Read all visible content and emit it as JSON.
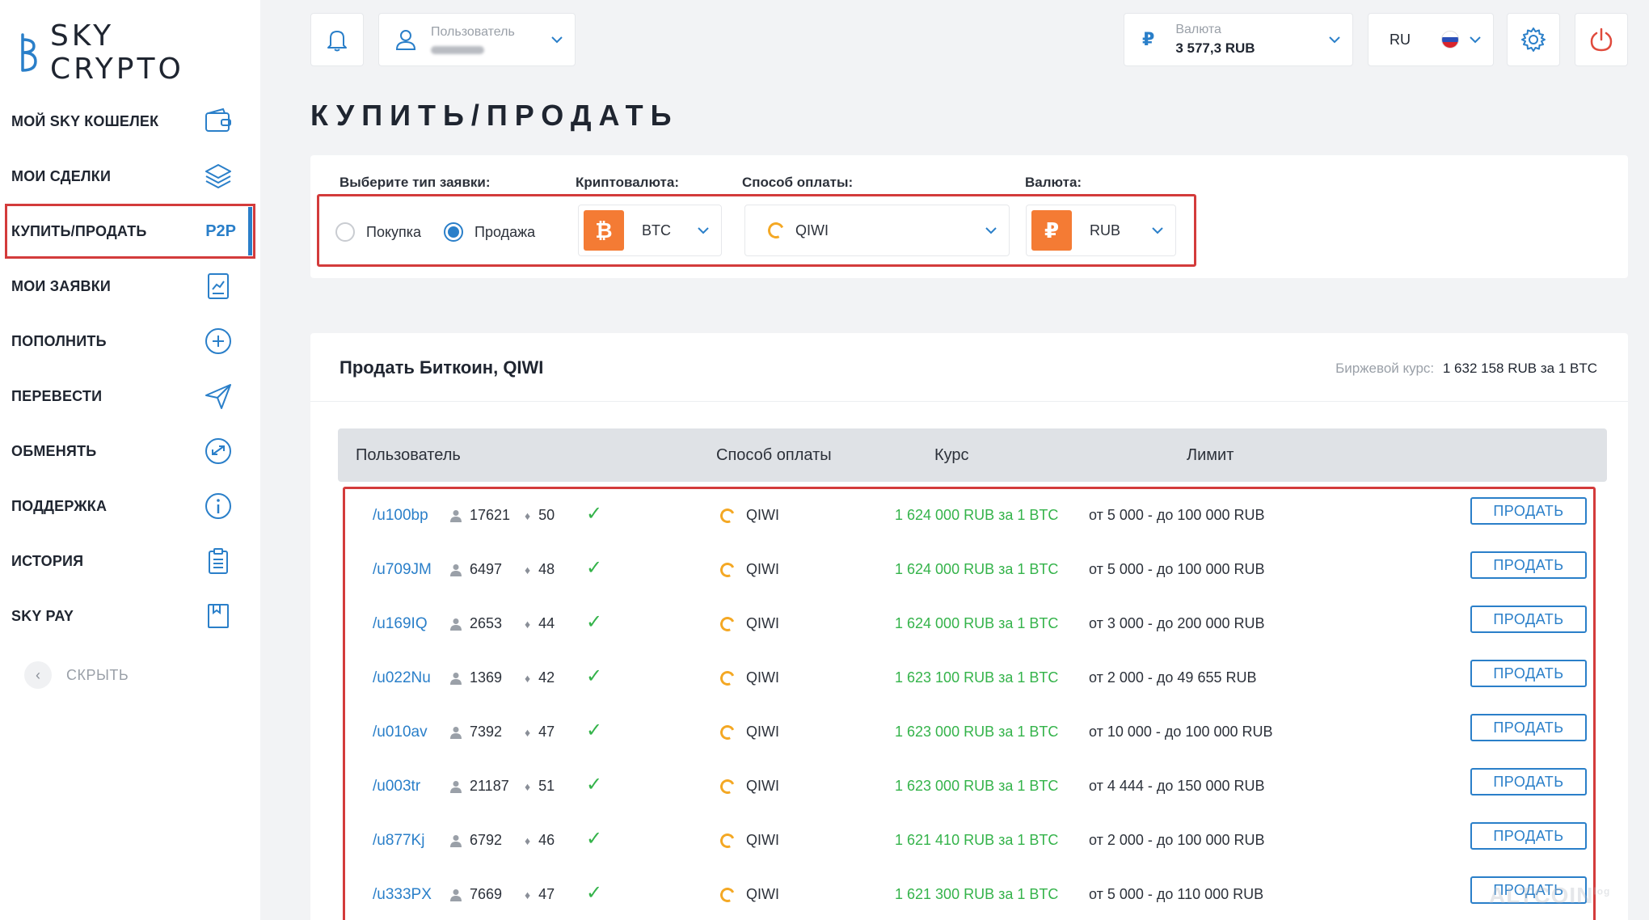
{
  "app": {
    "logo_text": "SKY CRYPTO"
  },
  "sidebar": {
    "items": [
      {
        "label": "МОЙ SKY КОШЕЛЕК",
        "icon": "wallet-icon"
      },
      {
        "label": "МОИ СДЕЛКИ",
        "icon": "layers-icon"
      },
      {
        "label": "КУПИТЬ/ПРОДАТЬ",
        "badge": "P2P",
        "active": true
      },
      {
        "label": "МОИ ЗАЯВКИ",
        "icon": "report-icon"
      },
      {
        "label": "ПОПОЛНИТЬ",
        "icon": "plus-circle-icon"
      },
      {
        "label": "ПЕРЕВЕСТИ",
        "icon": "send-icon"
      },
      {
        "label": "ОБМЕНЯТЬ",
        "icon": "exchange-icon"
      },
      {
        "label": "ПОДДЕРЖКА",
        "icon": "info-icon"
      },
      {
        "label": "ИСТОРИЯ",
        "icon": "clipboard-icon"
      },
      {
        "label": "SKY PAY",
        "icon": "book-icon"
      }
    ],
    "hide_label": "СКРЫТЬ"
  },
  "topbar": {
    "user_label": "Пользователь",
    "currency_label": "Валюта",
    "currency_symbol": "₽",
    "currency_value": "3 577,3 RUB",
    "lang": "RU"
  },
  "page": {
    "title": "КУПИТЬ/ПРОДАТЬ"
  },
  "filters": {
    "type_label": "Выберите тип заявки:",
    "crypto_label": "Криптовалюта:",
    "payment_label": "Способ оплаты:",
    "currency_label": "Валюта:",
    "buy_label": "Покупка",
    "sell_label": "Продажа",
    "selected_type": "sell",
    "crypto_value": "BTC",
    "crypto_symbol": "₿",
    "payment_value": "QIWI",
    "currency_value": "RUB",
    "currency_symbol": "₽"
  },
  "results": {
    "title": "Продать Биткоин, QIWI",
    "rate_label": "Биржевой курс:",
    "rate_value": "1 632 158 RUB за 1 BTC",
    "columns": {
      "user": "Пользователь",
      "payment": "Способ оплаты",
      "rate": "Курс",
      "limit": "Лимит"
    },
    "sell_button": "ПРОДАТЬ",
    "rows": [
      {
        "user": "/u100bp",
        "deals": "17621",
        "rating": "50",
        "payment": "QIWI",
        "rate": "1 624 000 RUB за 1 BTC",
        "limit": "от 5 000 - до 100 000 RUB"
      },
      {
        "user": "/u709JM",
        "deals": "6497",
        "rating": "48",
        "payment": "QIWI",
        "rate": "1 624 000 RUB за 1 BTC",
        "limit": "от 5 000 - до 100 000 RUB"
      },
      {
        "user": "/u169IQ",
        "deals": "2653",
        "rating": "44",
        "payment": "QIWI",
        "rate": "1 624 000 RUB за 1 BTC",
        "limit": "от 3 000 - до 200 000 RUB"
      },
      {
        "user": "/u022Nu",
        "deals": "1369",
        "rating": "42",
        "payment": "QIWI",
        "rate": "1 623 100 RUB за 1 BTC",
        "limit": "от 2 000 - до 49 655 RUB"
      },
      {
        "user": "/u010av",
        "deals": "7392",
        "rating": "47",
        "payment": "QIWI",
        "rate": "1 623 000 RUB за 1 BTC",
        "limit": "от 10 000 - до 100 000 RUB"
      },
      {
        "user": "/u003tr",
        "deals": "21187",
        "rating": "51",
        "payment": "QIWI",
        "rate": "1 623 000 RUB за 1 BTC",
        "limit": "от 4 444 - до 150 000 RUB"
      },
      {
        "user": "/u877Kj",
        "deals": "6792",
        "rating": "46",
        "payment": "QIWI",
        "rate": "1 621 410 RUB за 1 BTC",
        "limit": "от 2 000 - до 100 000 RUB"
      },
      {
        "user": "/u333PX",
        "deals": "7669",
        "rating": "47",
        "payment": "QIWI",
        "rate": "1 621 300 RUB за 1 BTC",
        "limit": "от 5 000 - до 110 000 RUB"
      }
    ]
  },
  "watermark": {
    "text": "ALTCOIN",
    "suffix": "log"
  },
  "colors": {
    "accent": "#2a7fc9",
    "highlight": "#d33b3b",
    "price": "#34b34a",
    "crypto_badge": "#f47b34",
    "qiwi": "#f4a824"
  }
}
